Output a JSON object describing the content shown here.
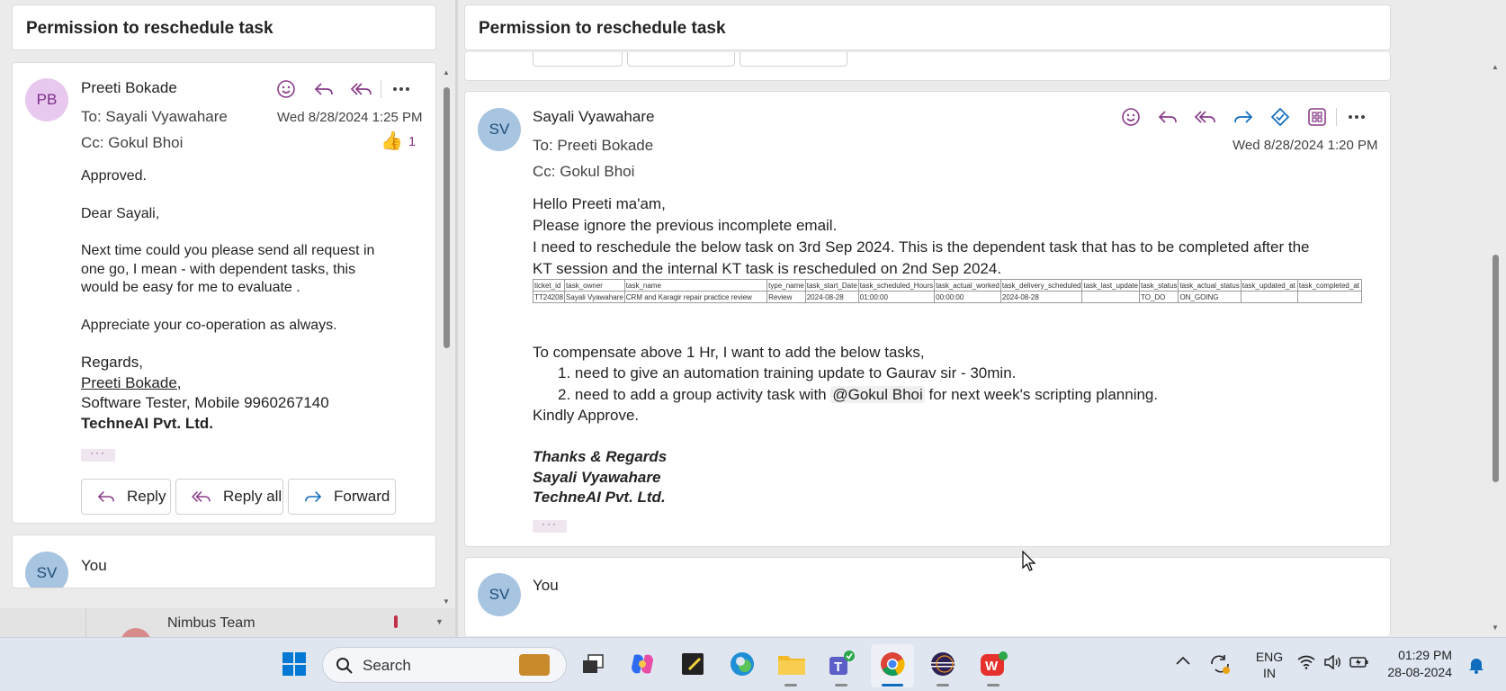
{
  "left": {
    "subject": "Permission to reschedule task",
    "message": {
      "initials": "PB",
      "sender": "Preeti Bokade",
      "to_label": "To:",
      "to": "Sayali Vyawahare",
      "cc_label": "Cc:",
      "cc": "Gokul Bhoi",
      "date": "Wed 8/28/2024 1:25 PM",
      "reaction_count": "1",
      "body": [
        "Approved.",
        "Dear Sayali,",
        "Next time could you please send all request in",
        "one go, I mean - with dependent tasks, this",
        "would be easy for me to evaluate .",
        "Appreciate your co-operation as always.",
        "Regards,"
      ],
      "sig_name": "Preeti Bokade,",
      "sig_role": "Software Tester, Mobile 9960267140",
      "sig_company": "TechneAI Pvt. Ltd.",
      "ellipsis": "···"
    },
    "actions": {
      "reply": "Reply",
      "reply_all": "Reply all",
      "forward": "Forward"
    },
    "next": {
      "initials": "SV",
      "sender": "You",
      "preview": "Nimbus Team"
    }
  },
  "right": {
    "subject": "Permission to reschedule task",
    "message": {
      "initials": "SV",
      "sender": "Sayali Vyawahare",
      "to_label": "To:",
      "to": "Preeti Bokade",
      "cc_label": "Cc:",
      "cc": "Gokul Bhoi",
      "date": "Wed 8/28/2024 1:20 PM",
      "greeting": "Hello Preeti ma'am,",
      "line1": "Please ignore the previous incomplete email.",
      "line2a": "I need to reschedule the below task on 3rd Sep 2024. This is the dependent task that has to be completed after the",
      "line2b": "KT session and the internal KT task is rescheduled on 2nd Sep 2024.",
      "table": {
        "headers": [
          "ticket_id",
          "task_owner",
          "task_name",
          "type_name",
          "task_start_Date",
          "task_scheduled_Hours",
          "task_actual_worked",
          "task_delivery_scheduled",
          "task_last_update",
          "task_status",
          "task_actual_status",
          "task_updated_at",
          "task_completed_at"
        ],
        "rows": [
          [
            "TT24208",
            "Sayali Vyawahare",
            "CRM and Karagir repair practice review",
            "Review",
            "2024-08-28",
            "01:00:00",
            "00:00:00",
            "2024-08-28",
            "",
            "TO_DO",
            "ON_GOING",
            "",
            ""
          ]
        ]
      },
      "compensate": "To compensate above 1 Hr, I want to add the below tasks,",
      "item1": "need to give an automation training update to Gaurav sir - 30min.",
      "item2_pre": "need to add a group activity task with ",
      "item2_mention": "@Gokul Bhoi",
      "item2_post": " for next week's scripting planning.",
      "approve": "Kindly Approve.",
      "thanks": "Thanks & Regards",
      "sig_name": "Sayali Vyawahare",
      "sig_company": "TechneAI Pvt. Ltd.",
      "ellipsis": "···"
    },
    "next": {
      "initials": "SV",
      "sender": "You"
    }
  },
  "taskbar": {
    "search_placeholder": "Search",
    "lang_top": "ENG",
    "lang_bottom": "IN",
    "time": "01:29 PM",
    "date": "28-08-2024"
  },
  "colors": {
    "accent": "#0f6cbd",
    "pb_avatar": "#e8c8ef",
    "sv_avatar": "#a7c4e0",
    "reaction": "#8a3d8a"
  }
}
